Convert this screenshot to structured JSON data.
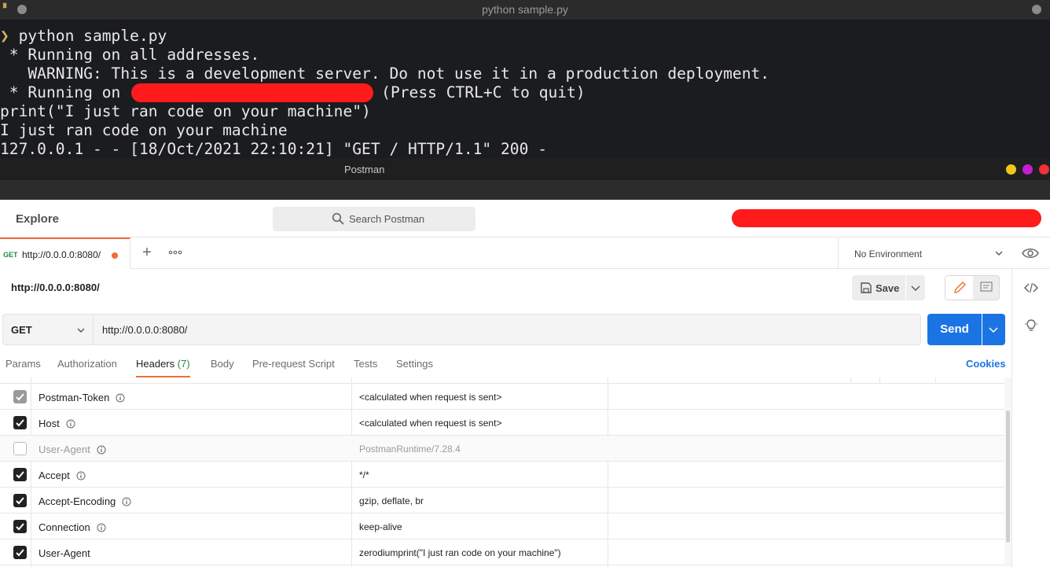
{
  "terminal": {
    "title": "python sample.py",
    "prompt_symbol": "❯",
    "command": " python sample.py",
    "lines": [
      " * Running on all addresses.",
      "   WARNING: This is a development server. Do not use it in a production deployment.",
      "print(\"I just ran code on your machine\")",
      "I just ran code on your machine",
      "127.0.0.1 - - [18/Oct/2021 22:10:21] \"GET / HTTP/1.1\" 200 -"
    ],
    "running_on_prefix": " * Running on ",
    "running_on_suffix": "(Press CTRL+C to quit)"
  },
  "postman": {
    "window_title": "Postman",
    "window_buttons": {
      "minimize_color": "#f5c518",
      "maximize_color": "#c31fd1",
      "close_color": "#f0303a"
    },
    "header": {
      "explore": "Explore",
      "search_placeholder": "Search Postman"
    },
    "tab": {
      "method": "GET",
      "url": "http://0.0.0.0:8080/"
    },
    "environment": "No Environment",
    "request_name": "http://0.0.0.0:8080/",
    "save_label": "Save",
    "method": "GET",
    "url": "http://0.0.0.0:8080/",
    "send_label": "Send",
    "subtabs": {
      "params": "Params",
      "authorization": "Authorization",
      "headers": "Headers",
      "headers_count": "(7)",
      "body": "Body",
      "prerequest": "Pre-request Script",
      "tests": "Tests",
      "settings": "Settings"
    },
    "cookies": "Cookies",
    "headers": [
      {
        "key": "Postman-Token",
        "value": "<calculated when request is sent>",
        "checked": true,
        "locked": true
      },
      {
        "key": "Host",
        "value": "<calculated when request is sent>",
        "checked": true,
        "locked": false
      },
      {
        "key": "User-Agent",
        "value": "PostmanRuntime/7.28.4",
        "checked": false,
        "locked": false
      },
      {
        "key": "Accept",
        "value": "*/*",
        "checked": true,
        "locked": false
      },
      {
        "key": "Accept-Encoding",
        "value": "gzip, deflate, br",
        "checked": true,
        "locked": false
      },
      {
        "key": "Connection",
        "value": "keep-alive",
        "checked": true,
        "locked": false
      },
      {
        "key": "User-Agent",
        "value": "zerodiumprint(\"I just ran code on your machine\")",
        "checked": true,
        "locked": false
      }
    ],
    "colors": {
      "accent": "#f26b3a",
      "primary": "#1b74e4",
      "get_method": "#1b8c3f"
    }
  }
}
